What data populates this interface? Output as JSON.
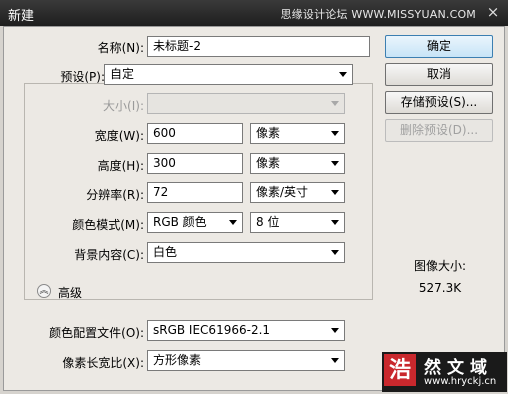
{
  "window": {
    "title": "新建",
    "watermark_top": "思缘设计论坛 WWW.MISSYUAN.COM",
    "close_glyph": "×"
  },
  "form": {
    "name_label": "名称(N):",
    "name_value": "未标题-2",
    "preset_label": "预设(P):",
    "preset_value": "自定",
    "size_label": "大小(I):",
    "size_value": "",
    "width_label": "宽度(W):",
    "width_value": "600",
    "width_unit": "像素",
    "height_label": "高度(H):",
    "height_value": "300",
    "height_unit": "像素",
    "resolution_label": "分辨率(R):",
    "resolution_value": "72",
    "resolution_unit": "像素/英寸",
    "color_mode_label": "颜色模式(M):",
    "color_mode_value": "RGB 颜色",
    "bit_depth_value": "8 位",
    "background_label": "背景内容(C):",
    "background_value": "白色",
    "advanced_label": "高级",
    "advanced_icon_glyph": "︽",
    "color_profile_label": "颜色配置文件(O):",
    "color_profile_value": "sRGB IEC61966-2.1",
    "pixel_aspect_label": "像素长宽比(X):",
    "pixel_aspect_value": "方形像素"
  },
  "buttons": {
    "ok": "确定",
    "cancel": "取消",
    "save_preset": "存储预设(S)...",
    "delete_preset": "删除预设(D)..."
  },
  "info": {
    "image_size_label": "图像大小:",
    "image_size_value": "527.3K"
  },
  "watermark_bottom": {
    "logo_char": "浩",
    "name": "然文域",
    "url": "www.hryckj.cn"
  }
}
